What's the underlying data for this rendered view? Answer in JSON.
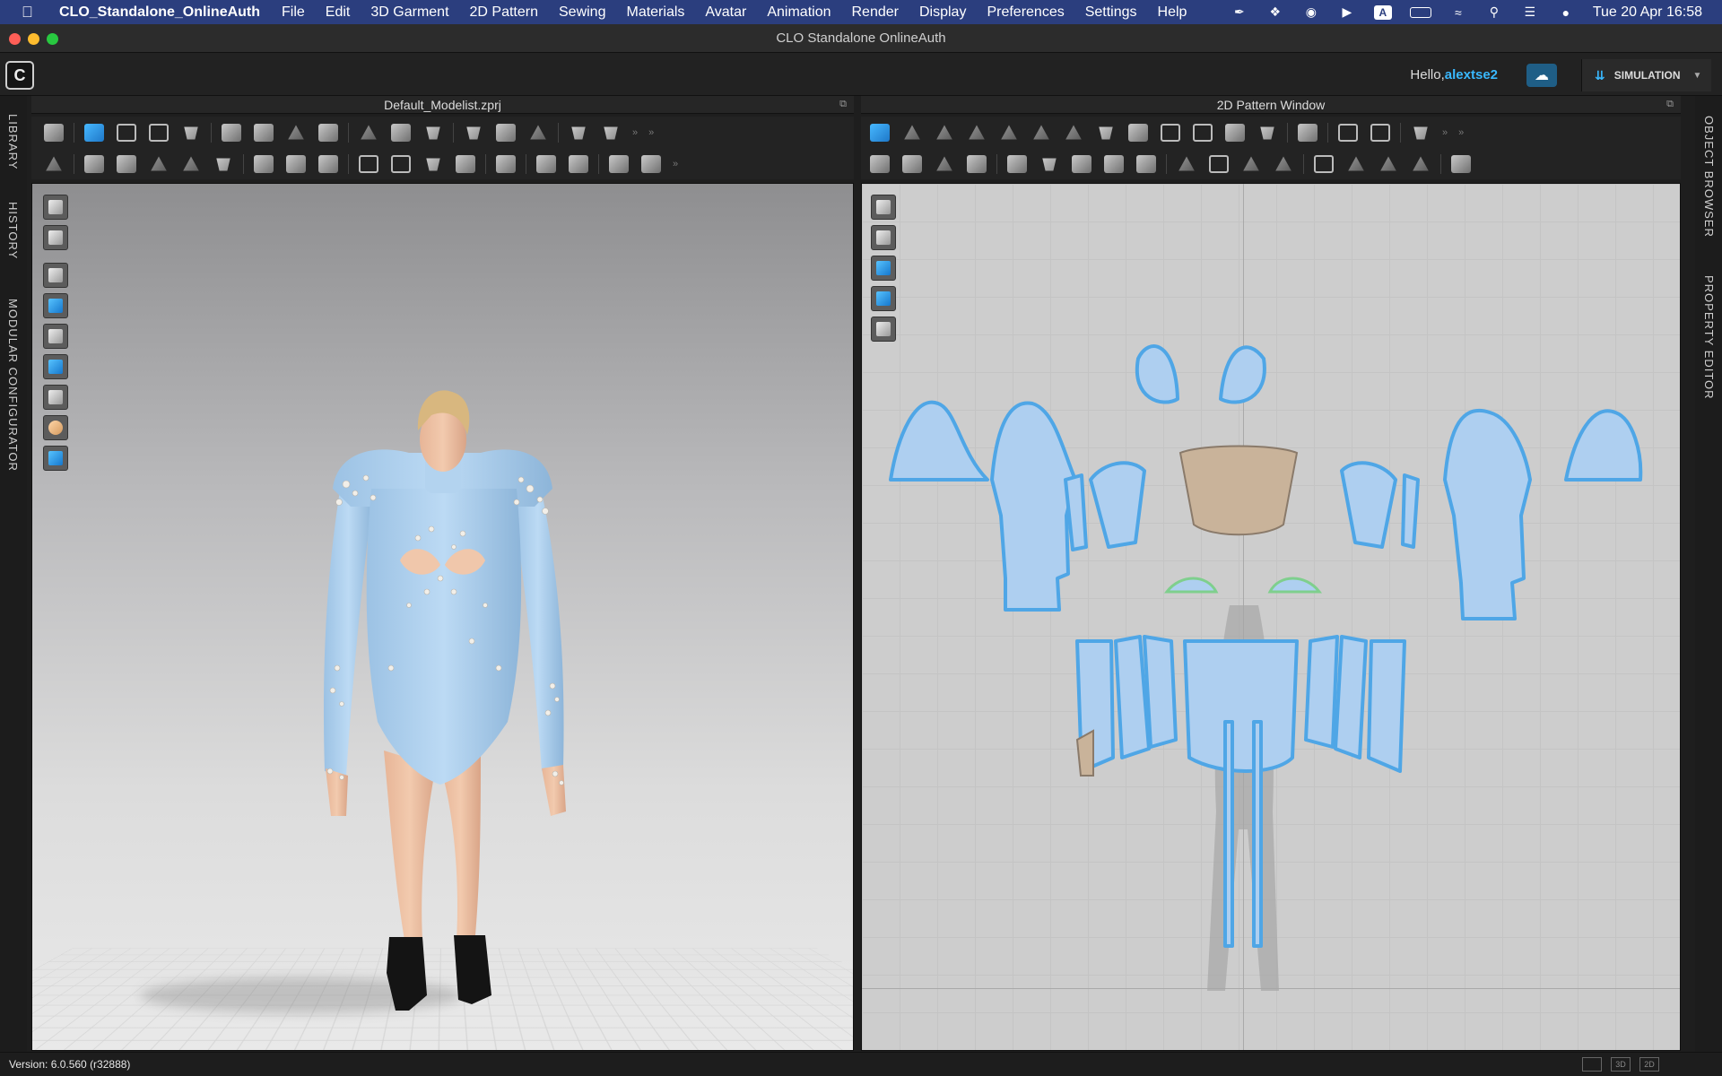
{
  "menubar": {
    "app_name": "CLO_Standalone_OnlineAuth",
    "items": [
      "File",
      "Edit",
      "3D Garment",
      "2D Pattern",
      "Sewing",
      "Materials",
      "Avatar",
      "Animation",
      "Render",
      "Display",
      "Preferences",
      "Settings",
      "Help"
    ],
    "clock": "Tue 20 Apr  16:58"
  },
  "window": {
    "title": "CLO Standalone OnlineAuth"
  },
  "header": {
    "greeting": "Hello,",
    "username": "alextse2",
    "simulation_label": "SIMULATION"
  },
  "left_tabs": [
    "LIBRARY",
    "HISTORY",
    "MODULAR CONFIGURATOR"
  ],
  "right_tabs": [
    "OBJECT BROWSER",
    "PROPERTY EDITOR"
  ],
  "panel3d": {
    "title": "Default_Modelist.zprj"
  },
  "panel2d": {
    "title": "2D Pattern Window"
  },
  "status": {
    "version": "Version: 6.0.560 (r32888)",
    "modes": [
      "",
      "3D",
      "2D"
    ]
  },
  "colors": {
    "fabric": "#a9cdee",
    "fabric_outline": "#4fa6e6",
    "accent": "#39b8ff",
    "menubar": "#2b3e7e"
  }
}
